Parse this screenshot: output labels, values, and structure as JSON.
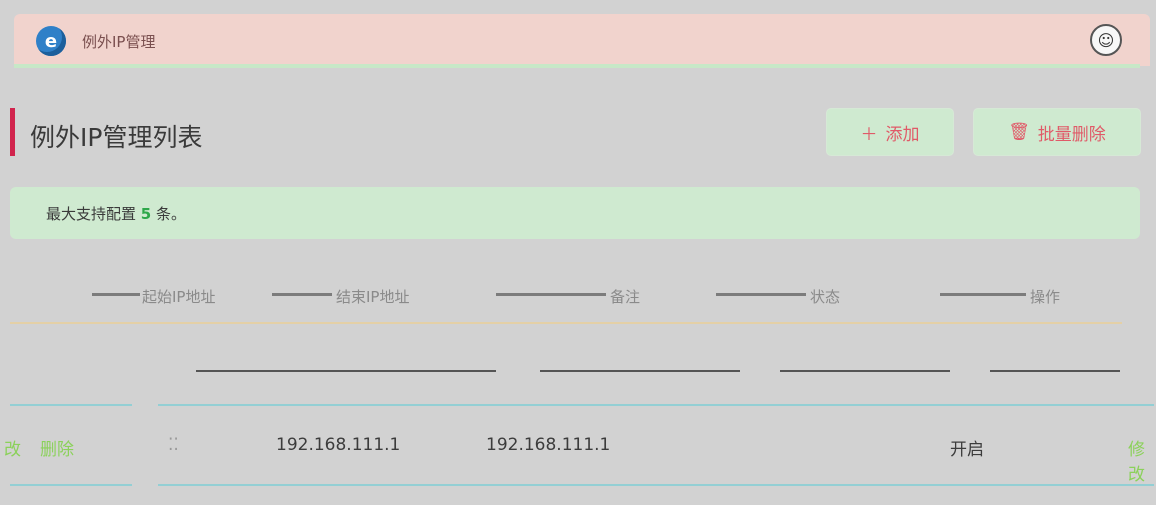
{
  "window": {
    "title": "例外IP管理"
  },
  "section": {
    "title": "例外IP管理列表"
  },
  "toolbar": {
    "add_label": "添加",
    "batch_delete_label": "批量删除"
  },
  "alert": {
    "prefix": "最大支持配置 ",
    "count": "5",
    "suffix": " 条。"
  },
  "table": {
    "headers": [
      "起始IP地址",
      "结束IP地址",
      "备注",
      "状态",
      "操作"
    ],
    "rows": [
      {
        "prev_action_fragment": "改",
        "delete": "删除",
        "start_ip": "192.168.111.1",
        "end_ip": "192.168.111.1",
        "remark": "",
        "status": "开启",
        "edit_fragment": "修改"
      }
    ]
  }
}
